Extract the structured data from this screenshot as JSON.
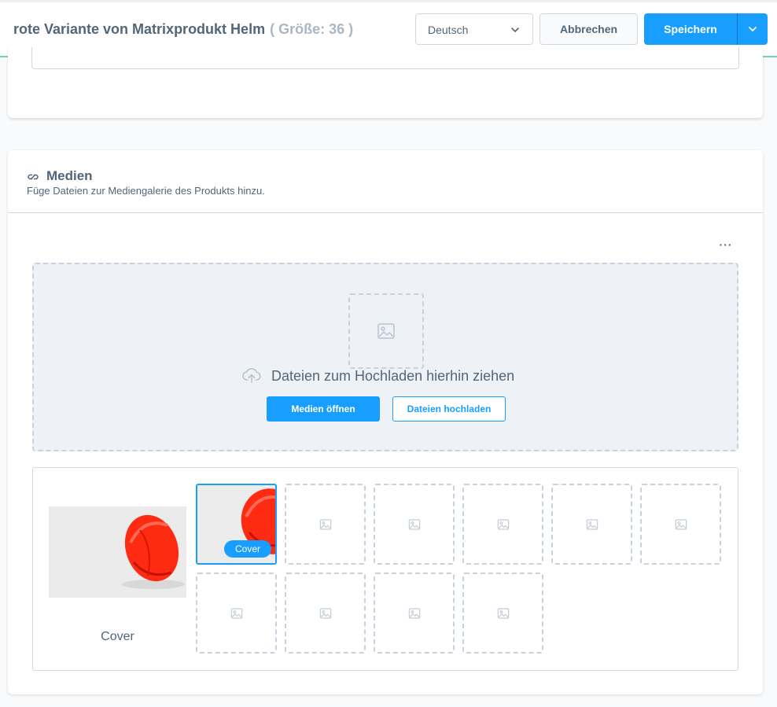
{
  "header": {
    "title": "rote Variante von Matrixprodukt Helm",
    "variant": "( Größe: 36 )",
    "language": "Deutsch",
    "cancel_label": "Abbrechen",
    "save_label": "Speichern"
  },
  "media": {
    "title": "Medien",
    "subtitle": "Füge Dateien zur Mediengalerie des Produkts hinzu.",
    "more_label": "···",
    "dropzone_text": "Dateien zum Hochladen hierhin ziehen",
    "open_media_label": "Medien öffnen",
    "upload_files_label": "Dateien hochladen",
    "cover_label": "Cover",
    "cover_badge": "Cover"
  },
  "colors": {
    "primary": "#189eff",
    "text": "#52667a",
    "header_accent": "#6fd3b7",
    "helmet": "#ff2a12"
  }
}
